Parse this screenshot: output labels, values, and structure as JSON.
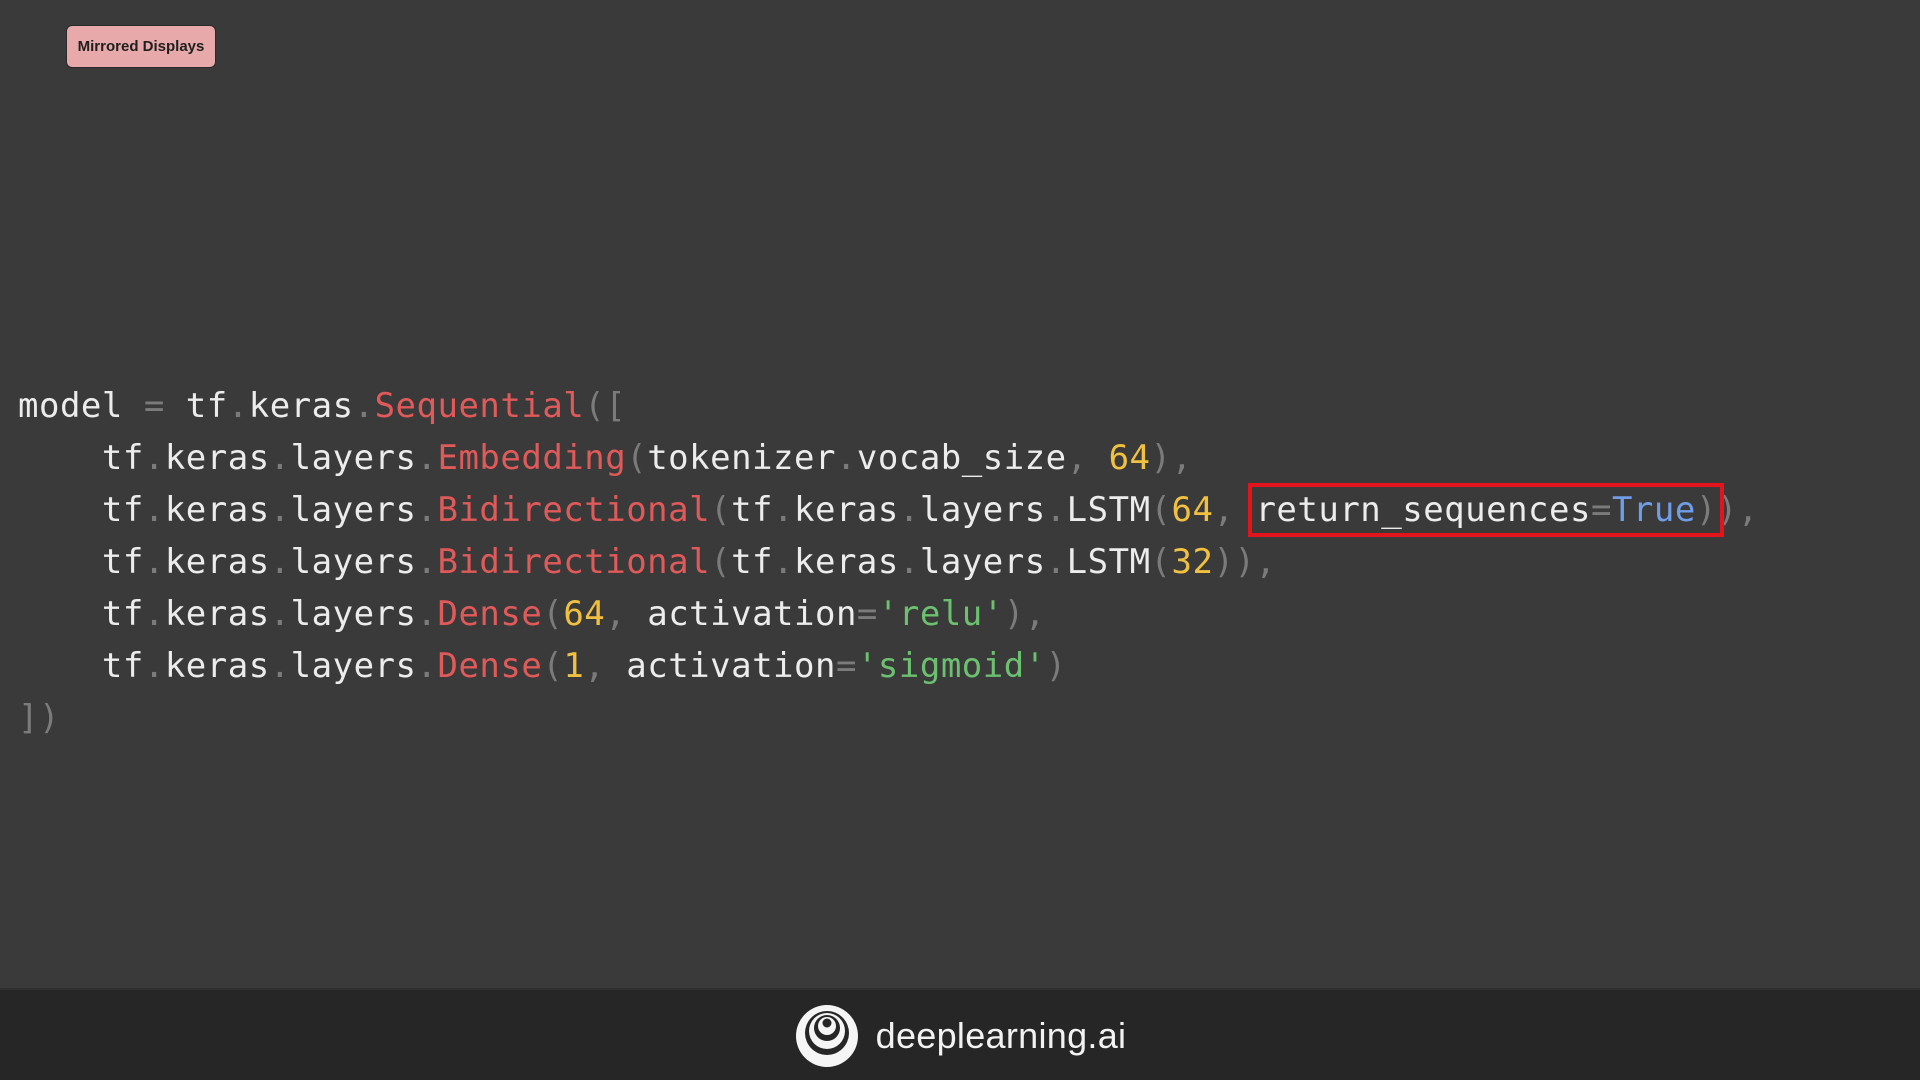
{
  "badge": {
    "label": "Mirrored Displays"
  },
  "code": {
    "lines": [
      [
        {
          "t": "model",
          "c": "id"
        },
        {
          "t": " = ",
          "c": "p"
        },
        {
          "t": "tf",
          "c": "id"
        },
        {
          "t": ".",
          "c": "p"
        },
        {
          "t": "keras",
          "c": "id"
        },
        {
          "t": ".",
          "c": "p"
        },
        {
          "t": "Sequential",
          "c": "f"
        },
        {
          "t": "([",
          "c": "p"
        }
      ],
      [
        {
          "t": "    tf",
          "c": "id"
        },
        {
          "t": ".",
          "c": "p"
        },
        {
          "t": "keras",
          "c": "id"
        },
        {
          "t": ".",
          "c": "p"
        },
        {
          "t": "layers",
          "c": "id"
        },
        {
          "t": ".",
          "c": "p"
        },
        {
          "t": "Embedding",
          "c": "f"
        },
        {
          "t": "(",
          "c": "p"
        },
        {
          "t": "tokenizer",
          "c": "id"
        },
        {
          "t": ".",
          "c": "p"
        },
        {
          "t": "vocab_size",
          "c": "id"
        },
        {
          "t": ", ",
          "c": "p"
        },
        {
          "t": "64",
          "c": "n"
        },
        {
          "t": "),",
          "c": "p"
        }
      ],
      [
        {
          "t": "    tf",
          "c": "id"
        },
        {
          "t": ".",
          "c": "p"
        },
        {
          "t": "keras",
          "c": "id"
        },
        {
          "t": ".",
          "c": "p"
        },
        {
          "t": "layers",
          "c": "id"
        },
        {
          "t": ".",
          "c": "p"
        },
        {
          "t": "Bidirectional",
          "c": "f"
        },
        {
          "t": "(",
          "c": "p"
        },
        {
          "t": "tf",
          "c": "id"
        },
        {
          "t": ".",
          "c": "p"
        },
        {
          "t": "keras",
          "c": "id"
        },
        {
          "t": ".",
          "c": "p"
        },
        {
          "t": "layers",
          "c": "id"
        },
        {
          "t": ".",
          "c": "p"
        },
        {
          "t": "LSTM",
          "c": "id"
        },
        {
          "t": "(",
          "c": "p"
        },
        {
          "t": "64",
          "c": "n"
        },
        {
          "t": ", ",
          "c": "p"
        },
        {
          "hl": true,
          "parts": [
            {
              "t": "return_sequences",
              "c": "id"
            },
            {
              "t": "=",
              "c": "p"
            },
            {
              "t": "True",
              "c": "k"
            },
            {
              "t": ")",
              "c": "p"
            }
          ]
        },
        {
          "t": "),",
          "c": "p"
        }
      ],
      [
        {
          "t": "    tf",
          "c": "id"
        },
        {
          "t": ".",
          "c": "p"
        },
        {
          "t": "keras",
          "c": "id"
        },
        {
          "t": ".",
          "c": "p"
        },
        {
          "t": "layers",
          "c": "id"
        },
        {
          "t": ".",
          "c": "p"
        },
        {
          "t": "Bidirectional",
          "c": "f"
        },
        {
          "t": "(",
          "c": "p"
        },
        {
          "t": "tf",
          "c": "id"
        },
        {
          "t": ".",
          "c": "p"
        },
        {
          "t": "keras",
          "c": "id"
        },
        {
          "t": ".",
          "c": "p"
        },
        {
          "t": "layers",
          "c": "id"
        },
        {
          "t": ".",
          "c": "p"
        },
        {
          "t": "LSTM",
          "c": "id"
        },
        {
          "t": "(",
          "c": "p"
        },
        {
          "t": "32",
          "c": "n"
        },
        {
          "t": ")),",
          "c": "p"
        }
      ],
      [
        {
          "t": "    tf",
          "c": "id"
        },
        {
          "t": ".",
          "c": "p"
        },
        {
          "t": "keras",
          "c": "id"
        },
        {
          "t": ".",
          "c": "p"
        },
        {
          "t": "layers",
          "c": "id"
        },
        {
          "t": ".",
          "c": "p"
        },
        {
          "t": "Dense",
          "c": "f"
        },
        {
          "t": "(",
          "c": "p"
        },
        {
          "t": "64",
          "c": "n"
        },
        {
          "t": ", ",
          "c": "p"
        },
        {
          "t": "activation",
          "c": "id"
        },
        {
          "t": "=",
          "c": "p"
        },
        {
          "t": "'relu'",
          "c": "s"
        },
        {
          "t": "),",
          "c": "p"
        }
      ],
      [
        {
          "t": "    tf",
          "c": "id"
        },
        {
          "t": ".",
          "c": "p"
        },
        {
          "t": "keras",
          "c": "id"
        },
        {
          "t": ".",
          "c": "p"
        },
        {
          "t": "layers",
          "c": "id"
        },
        {
          "t": ".",
          "c": "p"
        },
        {
          "t": "Dense",
          "c": "f"
        },
        {
          "t": "(",
          "c": "p"
        },
        {
          "t": "1",
          "c": "n"
        },
        {
          "t": ", ",
          "c": "p"
        },
        {
          "t": "activation",
          "c": "id"
        },
        {
          "t": "=",
          "c": "p"
        },
        {
          "t": "'sigmoid'",
          "c": "s"
        },
        {
          "t": ")",
          "c": "p"
        }
      ],
      [
        {
          "t": "])",
          "c": "p"
        }
      ]
    ]
  },
  "footer": {
    "brand": "deeplearning.ai",
    "logo_icon": "deeplearning-ai-logo-icon"
  },
  "colors": {
    "background": "#3a3a3a",
    "footer": "#262626",
    "function": "#e05a5a",
    "number": "#f0c040",
    "string": "#6cc070",
    "keyword": "#6f9de8",
    "highlight_box": "#e4141c"
  }
}
